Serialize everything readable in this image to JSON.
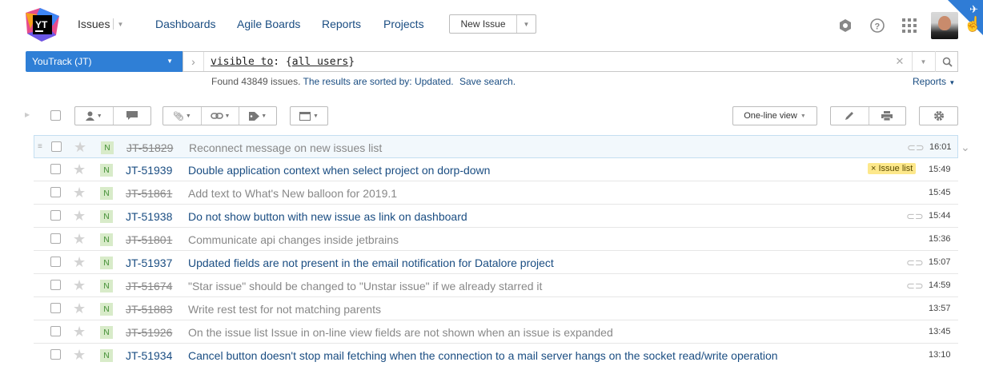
{
  "header": {
    "logo_text": "YT",
    "nav": {
      "issues": "Issues",
      "dashboards": "Dashboards",
      "agile_boards": "Agile Boards",
      "reports": "Reports",
      "projects": "Projects"
    },
    "new_issue_label": "New Issue"
  },
  "search": {
    "project": "YouTrack (JT)",
    "query_key": "visible to",
    "query_value": "all users",
    "found_text": "Found 43849 issues.",
    "sorted_text": "The results are sorted by: Updated.",
    "save_search": "Save search.",
    "reports_link": "Reports"
  },
  "toolbar": {
    "view_mode": "One-line view"
  },
  "issues": [
    {
      "id": "JT-51829",
      "resolved": true,
      "priority": "N",
      "summary": "Reconnect message on new issues list",
      "attachment": true,
      "tag": "",
      "time": "16:01"
    },
    {
      "id": "JT-51939",
      "resolved": false,
      "priority": "N",
      "summary": "Double application context when select project on dorp-down",
      "attachment": false,
      "tag": "× Issue list",
      "time": "15:49"
    },
    {
      "id": "JT-51861",
      "resolved": true,
      "priority": "N",
      "summary": "Add text to What's New balloon for 2019.1",
      "attachment": false,
      "tag": "",
      "time": "15:45"
    },
    {
      "id": "JT-51938",
      "resolved": false,
      "priority": "N",
      "summary": "Do not show button with new issue as link on dashboard",
      "attachment": true,
      "tag": "",
      "time": "15:44"
    },
    {
      "id": "JT-51801",
      "resolved": true,
      "priority": "N",
      "summary": "Communicate api changes inside jetbrains",
      "attachment": false,
      "tag": "",
      "time": "15:36"
    },
    {
      "id": "JT-51937",
      "resolved": false,
      "priority": "N",
      "summary": "Updated fields are not present in the email notification for Datalore project",
      "attachment": true,
      "tag": "",
      "time": "15:07"
    },
    {
      "id": "JT-51674",
      "resolved": true,
      "priority": "N",
      "summary": "\"Star issue\" should be changed to \"Unstar issue\" if we already starred it",
      "attachment": true,
      "tag": "",
      "time": "14:59"
    },
    {
      "id": "JT-51883",
      "resolved": true,
      "priority": "N",
      "summary": "Write rest test for not matching parents",
      "attachment": false,
      "tag": "",
      "time": "13:57"
    },
    {
      "id": "JT-51926",
      "resolved": true,
      "priority": "N",
      "summary": "On the issue list Issue in on-line view fields are not shown when an issue is expanded",
      "attachment": false,
      "tag": "",
      "time": "13:45"
    },
    {
      "id": "JT-51934",
      "resolved": false,
      "priority": "N",
      "summary": "Cancel button doesn't stop mail fetching when the connection to a mail server hangs on the socket read/write operation",
      "attachment": false,
      "tag": "",
      "time": "13:10"
    }
  ]
}
